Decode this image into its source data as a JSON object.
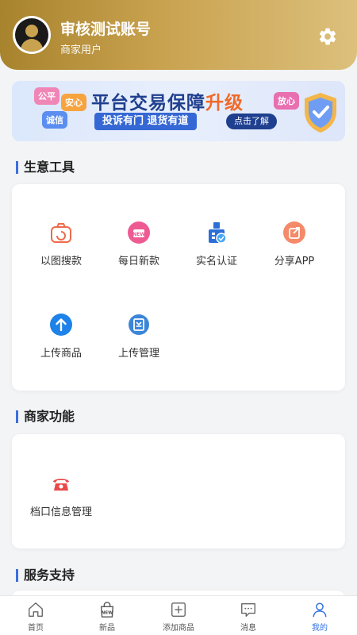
{
  "profile": {
    "name": "审核测试账号",
    "role": "商家用户"
  },
  "banner": {
    "tags": [
      "公平",
      "安心",
      "诚信",
      "放心"
    ],
    "title_main": "平台交易保障",
    "title_highlight": "升级",
    "subtitle": "投诉有门  退货有道",
    "button": "点击了解"
  },
  "sections": {
    "business_tools": "生意工具",
    "merchant_functions": "商家功能",
    "service_support": "服务支持"
  },
  "tools": [
    {
      "label": "以图搜款",
      "icon": "image-search-icon"
    },
    {
      "label": "每日新款",
      "icon": "new-arrivals-icon"
    },
    {
      "label": "实名认证",
      "icon": "verification-icon"
    },
    {
      "label": "分享APP",
      "icon": "share-icon"
    },
    {
      "label": "上传商品",
      "icon": "upload-icon"
    },
    {
      "label": "上传管理",
      "icon": "upload-manage-icon"
    }
  ],
  "merchant": [
    {
      "label": "档口信息管理",
      "icon": "phone-icon"
    }
  ],
  "tabbar": [
    {
      "label": "首页",
      "icon": "home-icon",
      "active": false
    },
    {
      "label": "新品",
      "icon": "new-bag-icon",
      "active": false
    },
    {
      "label": "添加商品",
      "icon": "add-icon",
      "active": false
    },
    {
      "label": "消息",
      "icon": "message-icon",
      "active": false
    },
    {
      "label": "我的",
      "icon": "user-icon",
      "active": true
    }
  ],
  "colors": {
    "gold": "#c9a24f",
    "accent": "#2f6fe4"
  }
}
